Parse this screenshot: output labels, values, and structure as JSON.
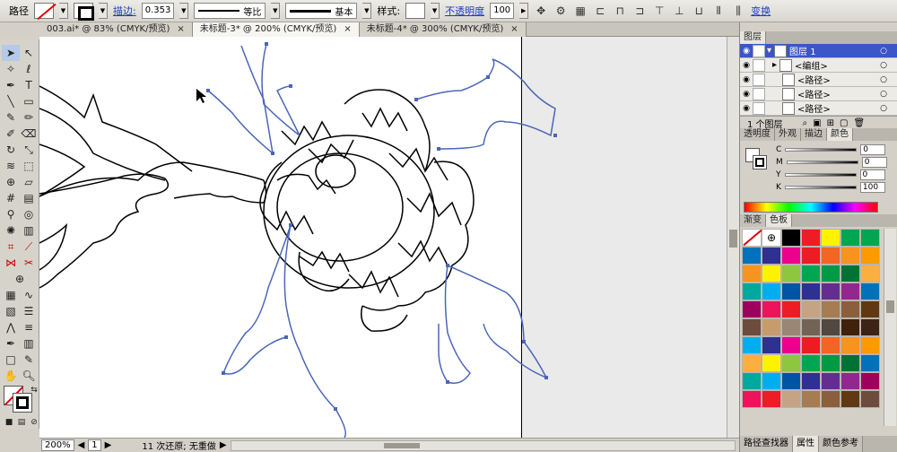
{
  "control_bar": {
    "object_type": "路径",
    "stroke_label": "描边:",
    "stroke_weight": "0.353",
    "profile_label": "等比",
    "brush_label": "基本",
    "style_label": "样式:",
    "opacity_label": "不透明度",
    "opacity_value": "100",
    "transform_label": "变换"
  },
  "tabs": [
    {
      "label": "003.ai* @ 83% (CMYK/预览)",
      "close": "×"
    },
    {
      "label": "未标题-3* @ 200% (CMYK/预览)",
      "close": "×"
    },
    {
      "label": "未标题-4* @ 300% (CMYK/预览)",
      "close": "×"
    }
  ],
  "status": {
    "zoom": "200%",
    "artboard": "1",
    "message": "11 次还原; 无重做"
  },
  "layers_panel": {
    "title": "图层",
    "rows": [
      {
        "name": "图层 1"
      },
      {
        "name": "<编组>"
      },
      {
        "name": "<路径>"
      },
      {
        "name": "<路径>"
      },
      {
        "name": "<路径>"
      }
    ],
    "footer": "1 个图层"
  },
  "color_panel": {
    "tabs": [
      "透明度",
      "外观",
      "描边",
      "颜色"
    ],
    "channels": [
      {
        "label": "C",
        "value": "0"
      },
      {
        "label": "M",
        "value": "0"
      },
      {
        "label": "Y",
        "value": "0"
      },
      {
        "label": "K",
        "value": "100"
      }
    ]
  },
  "swatch_panel": {
    "tabs": [
      "渐变",
      "色板"
    ],
    "colors": [
      "#ffffff",
      "#ffffff",
      "#000000",
      "#ee1c24",
      "#fff200",
      "#00a651",
      "#00a651",
      "#0072bc",
      "#2e3192",
      "#ec008c",
      "#ed1c24",
      "#f26522",
      "#f7941d",
      "#ff9900",
      "#f7941d",
      "#fff200",
      "#8dc63f",
      "#00a651",
      "#009a44",
      "#007236",
      "#fbaf3f",
      "#00a99d",
      "#00aeef",
      "#0054a6",
      "#2e3192",
      "#662d91",
      "#92278f",
      "#0072bc",
      "#9e005d",
      "#ed145b",
      "#ee1c24",
      "#c4a484",
      "#a67c52",
      "#8b5e3c",
      "#603913",
      "#6d4c3d",
      "#c69c6d",
      "#998675",
      "#736357",
      "#534741",
      "#42210b",
      "#3c2415",
      "#00aeef",
      "#2e3192",
      "#ec008c",
      "#ed1c24",
      "#f26522",
      "#f7941d",
      "#ff9900",
      "#fbaf3f",
      "#fff200",
      "#8dc63f",
      "#00a651",
      "#009a44",
      "#007236",
      "#0072bc",
      "#00a99d",
      "#00aeef",
      "#0054a6",
      "#2e3192",
      "#662d91",
      "#92278f",
      "#9e005d",
      "#ed145b",
      "#ee1c24",
      "#c4a484",
      "#a67c52",
      "#8b5e3c",
      "#603913",
      "#6d4c3d"
    ]
  },
  "bottom_tabs": [
    "路径查找器",
    "属性",
    "颜色参考"
  ]
}
